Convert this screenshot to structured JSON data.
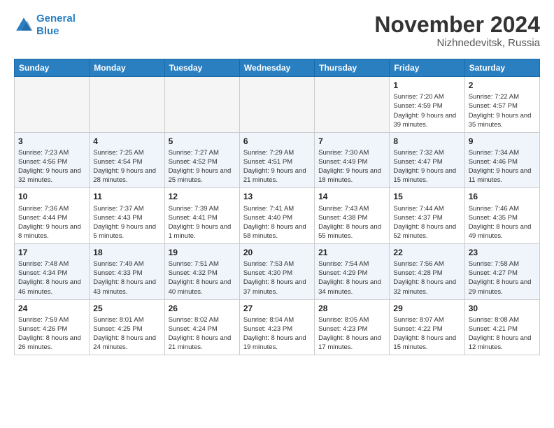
{
  "header": {
    "logo_line1": "General",
    "logo_line2": "Blue",
    "month_title": "November 2024",
    "location": "Nizhnedevitsk, Russia"
  },
  "weekdays": [
    "Sunday",
    "Monday",
    "Tuesday",
    "Wednesday",
    "Thursday",
    "Friday",
    "Saturday"
  ],
  "weeks": [
    [
      {
        "day": "",
        "info": ""
      },
      {
        "day": "",
        "info": ""
      },
      {
        "day": "",
        "info": ""
      },
      {
        "day": "",
        "info": ""
      },
      {
        "day": "",
        "info": ""
      },
      {
        "day": "1",
        "info": "Sunrise: 7:20 AM\nSunset: 4:59 PM\nDaylight: 9 hours\nand 39 minutes."
      },
      {
        "day": "2",
        "info": "Sunrise: 7:22 AM\nSunset: 4:57 PM\nDaylight: 9 hours\nand 35 minutes."
      }
    ],
    [
      {
        "day": "3",
        "info": "Sunrise: 7:23 AM\nSunset: 4:56 PM\nDaylight: 9 hours\nand 32 minutes."
      },
      {
        "day": "4",
        "info": "Sunrise: 7:25 AM\nSunset: 4:54 PM\nDaylight: 9 hours\nand 28 minutes."
      },
      {
        "day": "5",
        "info": "Sunrise: 7:27 AM\nSunset: 4:52 PM\nDaylight: 9 hours\nand 25 minutes."
      },
      {
        "day": "6",
        "info": "Sunrise: 7:29 AM\nSunset: 4:51 PM\nDaylight: 9 hours\nand 21 minutes."
      },
      {
        "day": "7",
        "info": "Sunrise: 7:30 AM\nSunset: 4:49 PM\nDaylight: 9 hours\nand 18 minutes."
      },
      {
        "day": "8",
        "info": "Sunrise: 7:32 AM\nSunset: 4:47 PM\nDaylight: 9 hours\nand 15 minutes."
      },
      {
        "day": "9",
        "info": "Sunrise: 7:34 AM\nSunset: 4:46 PM\nDaylight: 9 hours\nand 11 minutes."
      }
    ],
    [
      {
        "day": "10",
        "info": "Sunrise: 7:36 AM\nSunset: 4:44 PM\nDaylight: 9 hours\nand 8 minutes."
      },
      {
        "day": "11",
        "info": "Sunrise: 7:37 AM\nSunset: 4:43 PM\nDaylight: 9 hours\nand 5 minutes."
      },
      {
        "day": "12",
        "info": "Sunrise: 7:39 AM\nSunset: 4:41 PM\nDaylight: 9 hours\nand 1 minute."
      },
      {
        "day": "13",
        "info": "Sunrise: 7:41 AM\nSunset: 4:40 PM\nDaylight: 8 hours\nand 58 minutes."
      },
      {
        "day": "14",
        "info": "Sunrise: 7:43 AM\nSunset: 4:38 PM\nDaylight: 8 hours\nand 55 minutes."
      },
      {
        "day": "15",
        "info": "Sunrise: 7:44 AM\nSunset: 4:37 PM\nDaylight: 8 hours\nand 52 minutes."
      },
      {
        "day": "16",
        "info": "Sunrise: 7:46 AM\nSunset: 4:35 PM\nDaylight: 8 hours\nand 49 minutes."
      }
    ],
    [
      {
        "day": "17",
        "info": "Sunrise: 7:48 AM\nSunset: 4:34 PM\nDaylight: 8 hours\nand 46 minutes."
      },
      {
        "day": "18",
        "info": "Sunrise: 7:49 AM\nSunset: 4:33 PM\nDaylight: 8 hours\nand 43 minutes."
      },
      {
        "day": "19",
        "info": "Sunrise: 7:51 AM\nSunset: 4:32 PM\nDaylight: 8 hours\nand 40 minutes."
      },
      {
        "day": "20",
        "info": "Sunrise: 7:53 AM\nSunset: 4:30 PM\nDaylight: 8 hours\nand 37 minutes."
      },
      {
        "day": "21",
        "info": "Sunrise: 7:54 AM\nSunset: 4:29 PM\nDaylight: 8 hours\nand 34 minutes."
      },
      {
        "day": "22",
        "info": "Sunrise: 7:56 AM\nSunset: 4:28 PM\nDaylight: 8 hours\nand 32 minutes."
      },
      {
        "day": "23",
        "info": "Sunrise: 7:58 AM\nSunset: 4:27 PM\nDaylight: 8 hours\nand 29 minutes."
      }
    ],
    [
      {
        "day": "24",
        "info": "Sunrise: 7:59 AM\nSunset: 4:26 PM\nDaylight: 8 hours\nand 26 minutes."
      },
      {
        "day": "25",
        "info": "Sunrise: 8:01 AM\nSunset: 4:25 PM\nDaylight: 8 hours\nand 24 minutes."
      },
      {
        "day": "26",
        "info": "Sunrise: 8:02 AM\nSunset: 4:24 PM\nDaylight: 8 hours\nand 21 minutes."
      },
      {
        "day": "27",
        "info": "Sunrise: 8:04 AM\nSunset: 4:23 PM\nDaylight: 8 hours\nand 19 minutes."
      },
      {
        "day": "28",
        "info": "Sunrise: 8:05 AM\nSunset: 4:23 PM\nDaylight: 8 hours\nand 17 minutes."
      },
      {
        "day": "29",
        "info": "Sunrise: 8:07 AM\nSunset: 4:22 PM\nDaylight: 8 hours\nand 15 minutes."
      },
      {
        "day": "30",
        "info": "Sunrise: 8:08 AM\nSunset: 4:21 PM\nDaylight: 8 hours\nand 12 minutes."
      }
    ]
  ]
}
